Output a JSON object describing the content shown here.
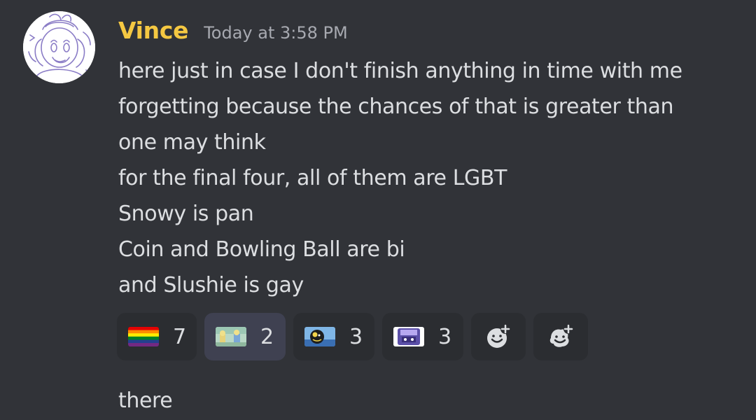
{
  "message": {
    "username": "Vince",
    "timestamp": "Today at 3:58 PM",
    "lines": [
      "here just in case I don't finish anything in time with me",
      "forgetting because the chances of that is greater than",
      "one may think",
      "for the final four, all of them are LGBT",
      "Snowy is pan",
      "Coin and Bowling Ball are bi",
      "and Slushie is gay"
    ],
    "avatar": "vince-sketch-avatar"
  },
  "reactions": [
    {
      "emoji": "pride-flag-emoji",
      "count": "7",
      "selected": false
    },
    {
      "emoji": "custom-characters-emoji",
      "count": "2",
      "selected": true
    },
    {
      "emoji": "custom-bowling-ball-emoji",
      "count": "3",
      "selected": false
    },
    {
      "emoji": "custom-slushie-emoji",
      "count": "3",
      "selected": false
    }
  ],
  "add_reaction_icons": [
    "add-reaction-icon",
    "add-super-reaction-icon"
  ],
  "followup_message": "there",
  "colors": {
    "background": "#313338",
    "username": "#f5c842",
    "text": "#dcdee1",
    "timestamp": "#a7a9b0",
    "reaction_bg": "#2b2d31",
    "reaction_selected_bg": "#3f4151"
  }
}
